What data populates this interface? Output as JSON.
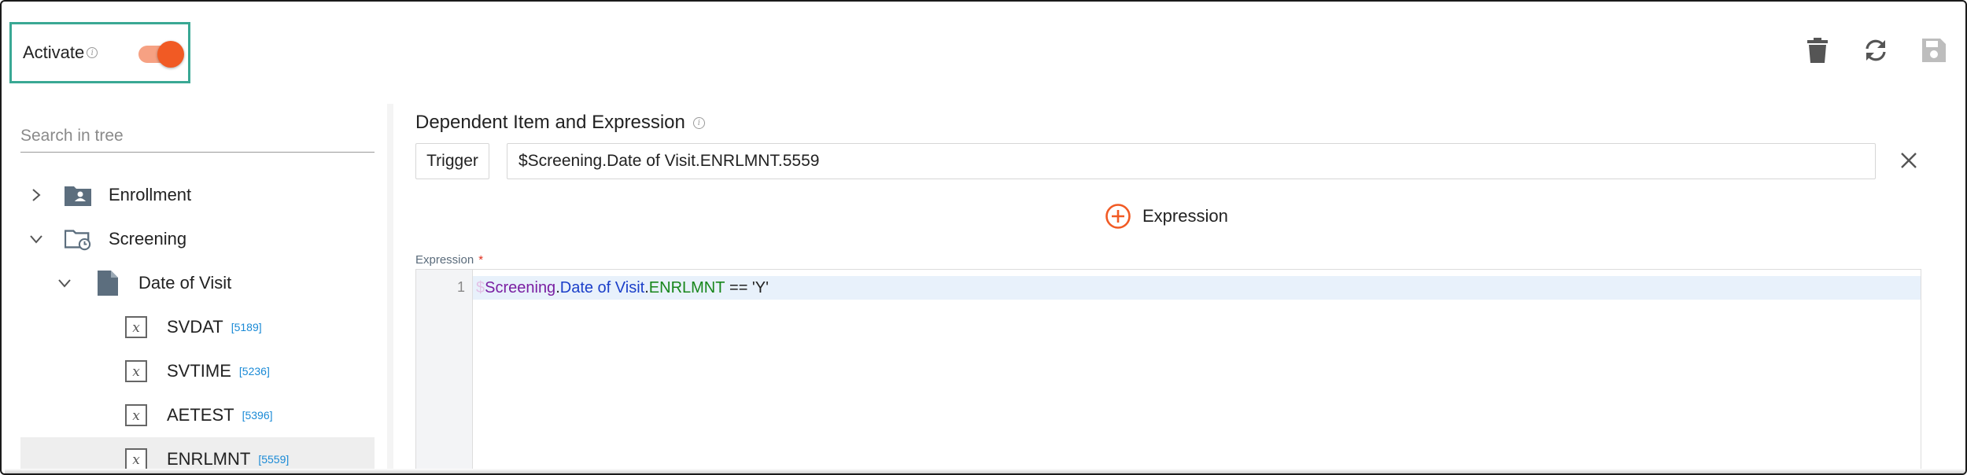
{
  "header": {
    "activate_label": "Activate",
    "activate_on": true,
    "actions": [
      {
        "name": "delete",
        "icon": "trash-icon"
      },
      {
        "name": "refresh",
        "icon": "refresh-icon"
      },
      {
        "name": "save",
        "icon": "save-icon"
      }
    ]
  },
  "tree": {
    "search_placeholder": "Search in tree",
    "nodes": [
      {
        "label": "Enrollment",
        "expanded": false,
        "icon": "folder-person-icon"
      },
      {
        "label": "Screening",
        "expanded": true,
        "icon": "folder-clock-icon"
      },
      {
        "label": "Date of Visit",
        "expanded": true,
        "icon": "document-icon"
      },
      {
        "label": "SVDAT",
        "id": "[5189]",
        "icon": "variable-icon"
      },
      {
        "label": "SVTIME",
        "id": "[5236]",
        "icon": "variable-icon"
      },
      {
        "label": "AETEST",
        "id": "[5396]",
        "icon": "variable-icon"
      },
      {
        "label": "ENRLMNT",
        "id": "[5559]",
        "icon": "variable-icon",
        "selected": true
      }
    ]
  },
  "dependent": {
    "title": "Dependent Item and Expression",
    "trigger_label": "Trigger",
    "trigger_value": "$Screening.Date of Visit.ENRLMNT.5559"
  },
  "add_expression_label": "Expression",
  "expression": {
    "label": "Expression",
    "required_mark": "*",
    "line_number": "1",
    "tokens": {
      "sigil": "$",
      "ns": "Screening",
      "dot1": ".",
      "prop": "Date of Visit",
      "dot2": ".",
      "item": "ENRLMNT",
      "rest": " == 'Y'"
    }
  },
  "colors": {
    "accent": "#f15a24",
    "highlight_border": "#3aa894",
    "link_id": "#1a8ad6"
  }
}
